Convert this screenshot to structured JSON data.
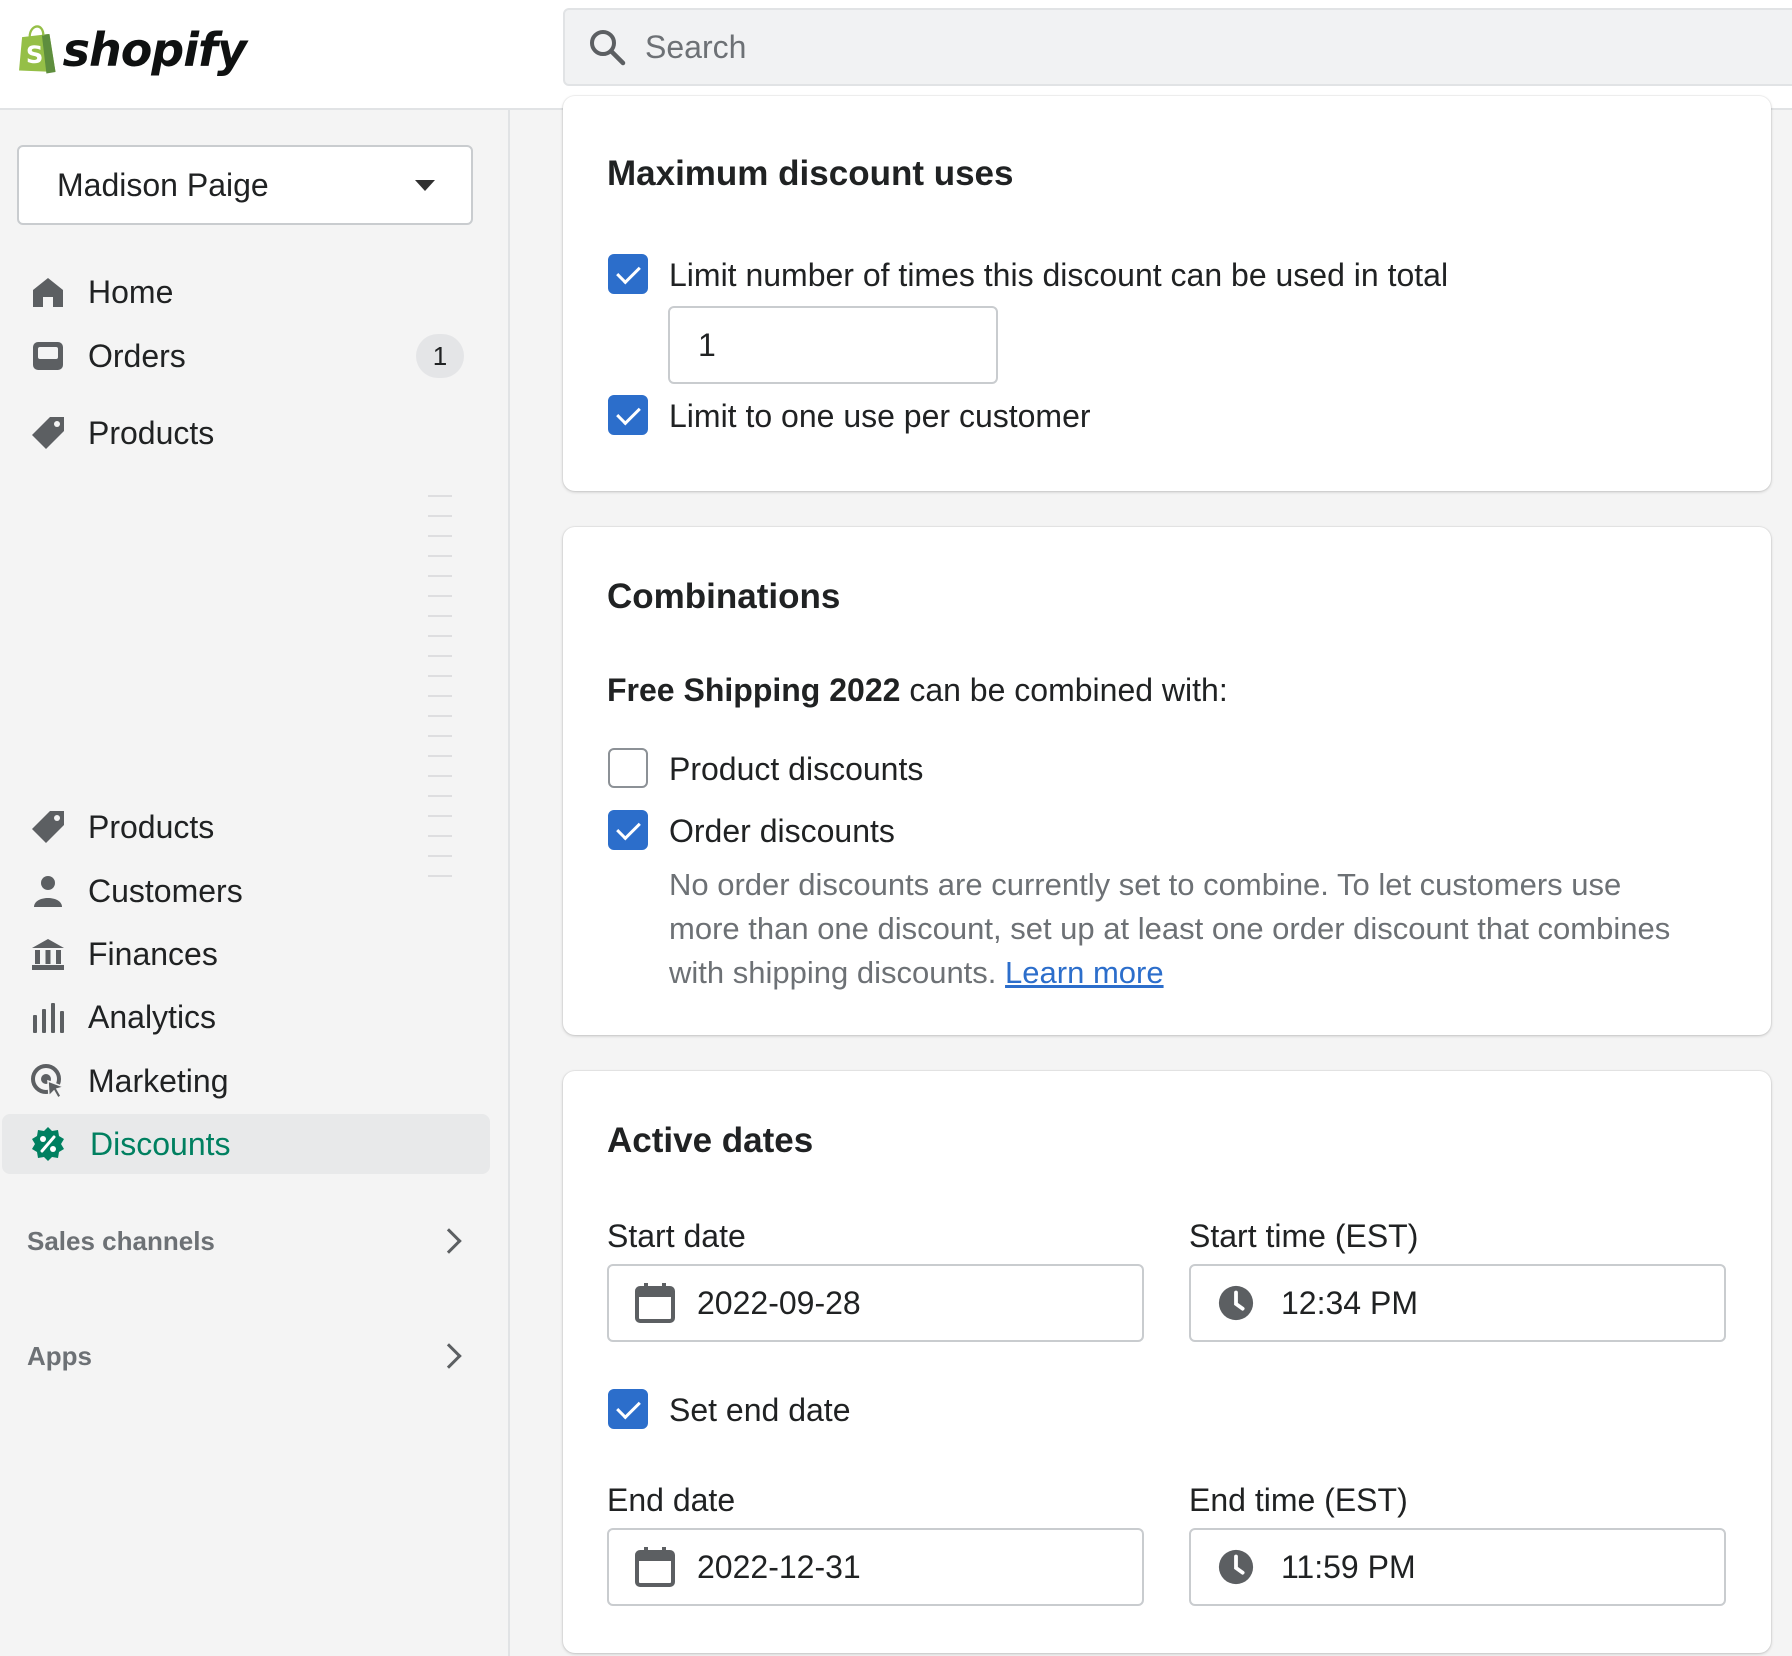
{
  "brand": {
    "logo_text": "shopify",
    "accent": "#008060",
    "link": "#2c6ecb",
    "checkbox_on": "#2c6ecb"
  },
  "search": {
    "placeholder": "Search",
    "icon": "search-icon"
  },
  "sidebar": {
    "store_name": "Madison Paige",
    "top_items": [
      {
        "label": "Home",
        "icon": "home-icon"
      },
      {
        "label": "Orders",
        "icon": "orders-icon",
        "badge": "1"
      },
      {
        "label": "Products",
        "icon": "tag-icon"
      }
    ],
    "items": [
      {
        "label": "Products",
        "icon": "tag-icon"
      },
      {
        "label": "Customers",
        "icon": "person-icon"
      },
      {
        "label": "Finances",
        "icon": "bank-icon"
      },
      {
        "label": "Analytics",
        "icon": "bar-chart-icon"
      },
      {
        "label": "Marketing",
        "icon": "target-icon"
      },
      {
        "label": "Discounts",
        "icon": "discount-icon",
        "active": true
      }
    ],
    "sections": [
      {
        "label": "Sales channels"
      },
      {
        "label": "Apps"
      }
    ]
  },
  "max_uses": {
    "title": "Maximum discount uses",
    "limit_total_label": "Limit number of times this discount can be used in total",
    "limit_total_checked": true,
    "limit_total_value": "1",
    "one_per_customer_label": "Limit to one use per customer",
    "one_per_customer_checked": true
  },
  "combinations": {
    "title": "Combinations",
    "discount_name": "Free Shipping 2022",
    "intro_suffix": "can be combined with:",
    "product_discounts_label": "Product discounts",
    "product_discounts_checked": false,
    "order_discounts_label": "Order discounts",
    "order_discounts_checked": true,
    "help_line1": "No order discounts are currently set to combine. To let customers use",
    "help_line2": "more than one discount, set up at least one order discount that combines",
    "help_line3": "with shipping discounts.",
    "learn_more": "Learn more"
  },
  "active_dates": {
    "title": "Active dates",
    "start_date_label": "Start date",
    "start_date": "2022-09-28",
    "start_time_label": "Start time (EST)",
    "start_time": "12:34 PM",
    "set_end_date_label": "Set end date",
    "set_end_date_checked": true,
    "end_date_label": "End date",
    "end_date": "2022-12-31",
    "end_time_label": "End time (EST)",
    "end_time": "11:59 PM"
  }
}
